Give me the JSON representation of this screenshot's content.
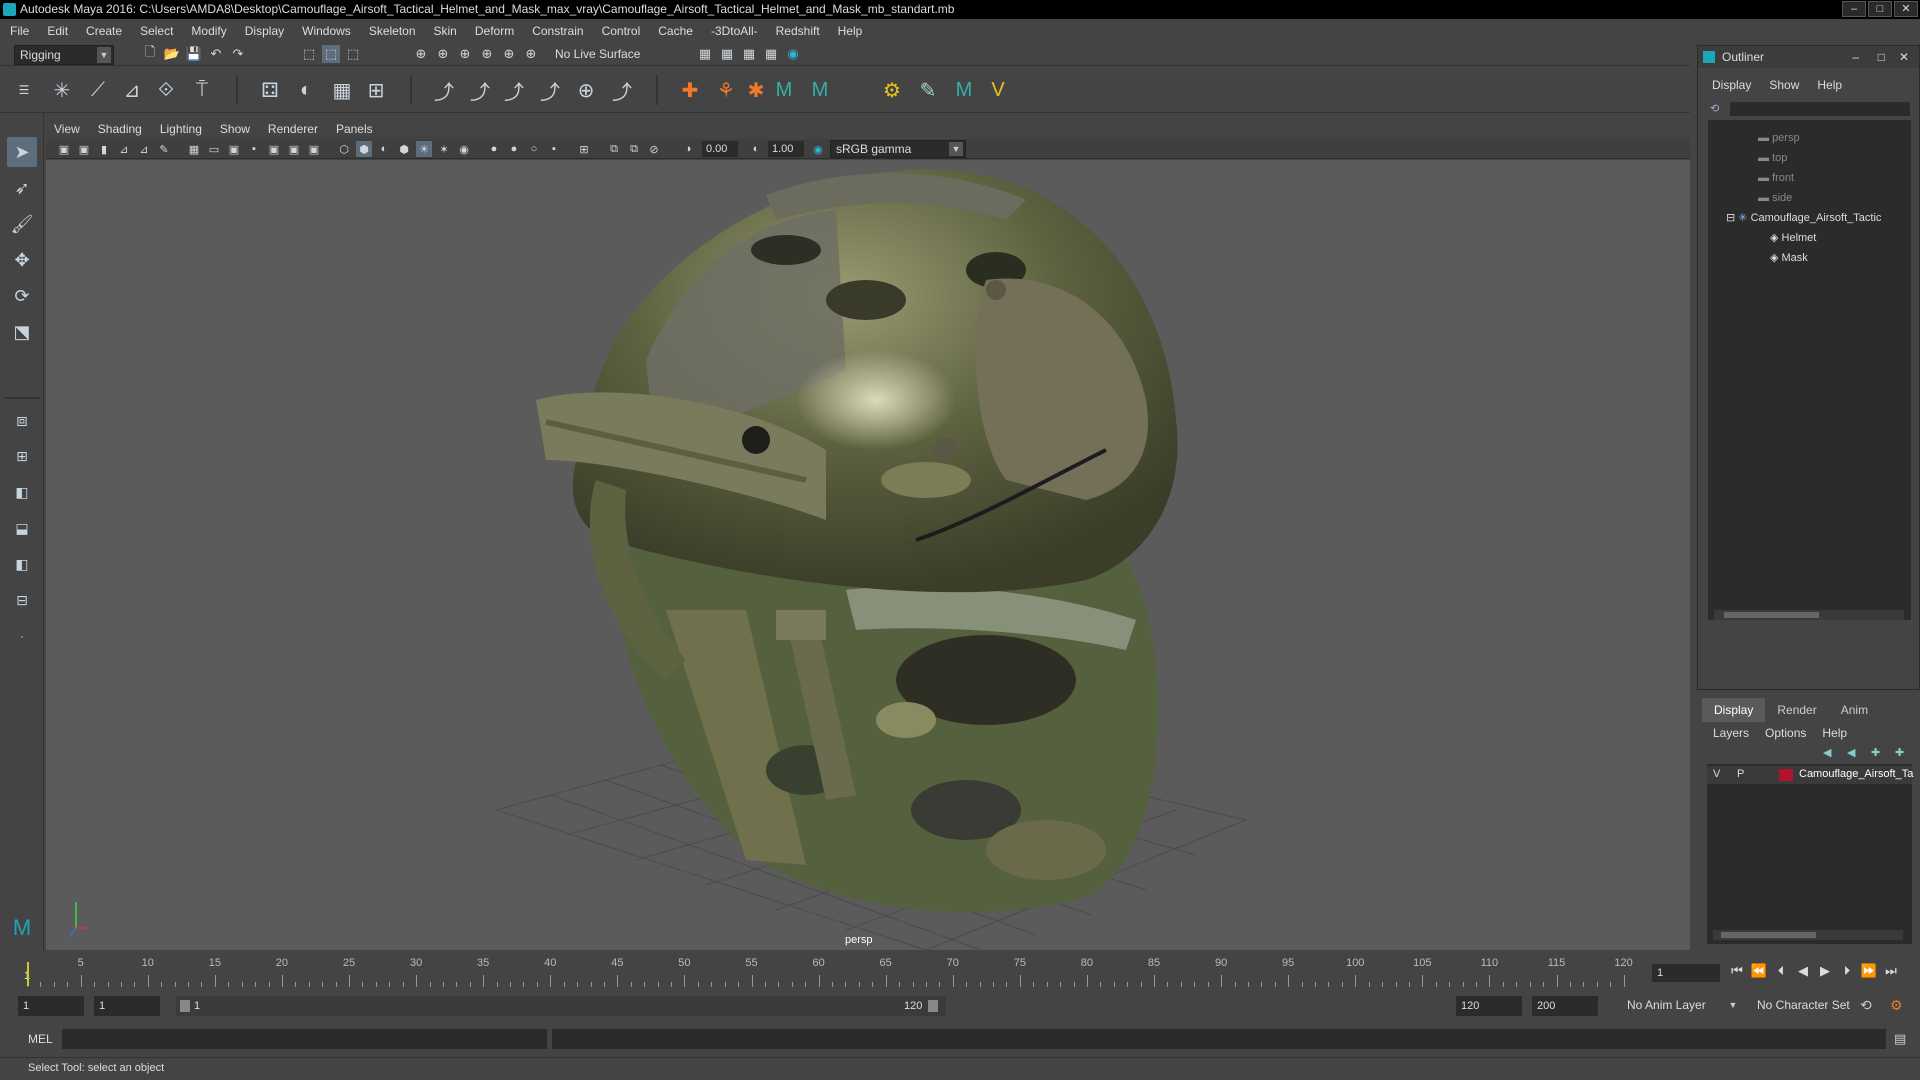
{
  "window": {
    "title": "Autodesk Maya 2016: C:\\Users\\AMDA8\\Desktop\\Camouflage_Airsoft_Tactical_Helmet_and_Mask_max_vray\\Camouflage_Airsoft_Tactical_Helmet_and_Mask_mb_standart.mb"
  },
  "menubar": [
    "File",
    "Edit",
    "Create",
    "Select",
    "Modify",
    "Display",
    "Windows",
    "Skeleton",
    "Skin",
    "Deform",
    "Constrain",
    "Control",
    "Cache",
    "-3DtoAll-",
    "Redshift",
    "Help"
  ],
  "statusline": {
    "mode": "Rigging",
    "live_surface": "No Live Surface"
  },
  "panel": {
    "menus": [
      "View",
      "Shading",
      "Lighting",
      "Show",
      "Renderer",
      "Panels"
    ],
    "exposure": "0.00",
    "gamma": "1.00",
    "color_space": "sRGB gamma",
    "camera_label": "persp"
  },
  "outliner": {
    "title": "Outliner",
    "menus": [
      "Display",
      "Show",
      "Help"
    ],
    "items": [
      {
        "label": "persp",
        "kind": "camera"
      },
      {
        "label": "top",
        "kind": "camera"
      },
      {
        "label": "front",
        "kind": "camera"
      },
      {
        "label": "side",
        "kind": "camera"
      },
      {
        "label": "Camouflage_Airsoft_Tactic",
        "kind": "group"
      },
      {
        "label": "Helmet",
        "kind": "mesh"
      },
      {
        "label": "Mask",
        "kind": "mesh"
      }
    ]
  },
  "layer_editor": {
    "tabs": [
      "Display",
      "Render",
      "Anim"
    ],
    "menus": [
      "Layers",
      "Options",
      "Help"
    ],
    "layer": {
      "v": "V",
      "p": "P",
      "name": "Camouflage_Airsoft_Ta",
      "color": "#b3132b"
    }
  },
  "timeline": {
    "ticks": [
      5,
      10,
      15,
      20,
      25,
      30,
      35,
      40,
      45,
      50,
      55,
      60,
      65,
      70,
      75,
      80,
      85,
      90,
      95,
      100,
      105,
      110,
      115,
      120
    ],
    "start_marker": "1",
    "current_frame": "1"
  },
  "range": {
    "start": "1",
    "playback_start": "1",
    "slider_start": "1",
    "slider_end": "120",
    "playback_end": "120",
    "end": "200",
    "anim_layer": "No Anim Layer",
    "character_set": "No Character Set"
  },
  "command": {
    "language": "MEL"
  },
  "help_line": "Select Tool: select an object"
}
